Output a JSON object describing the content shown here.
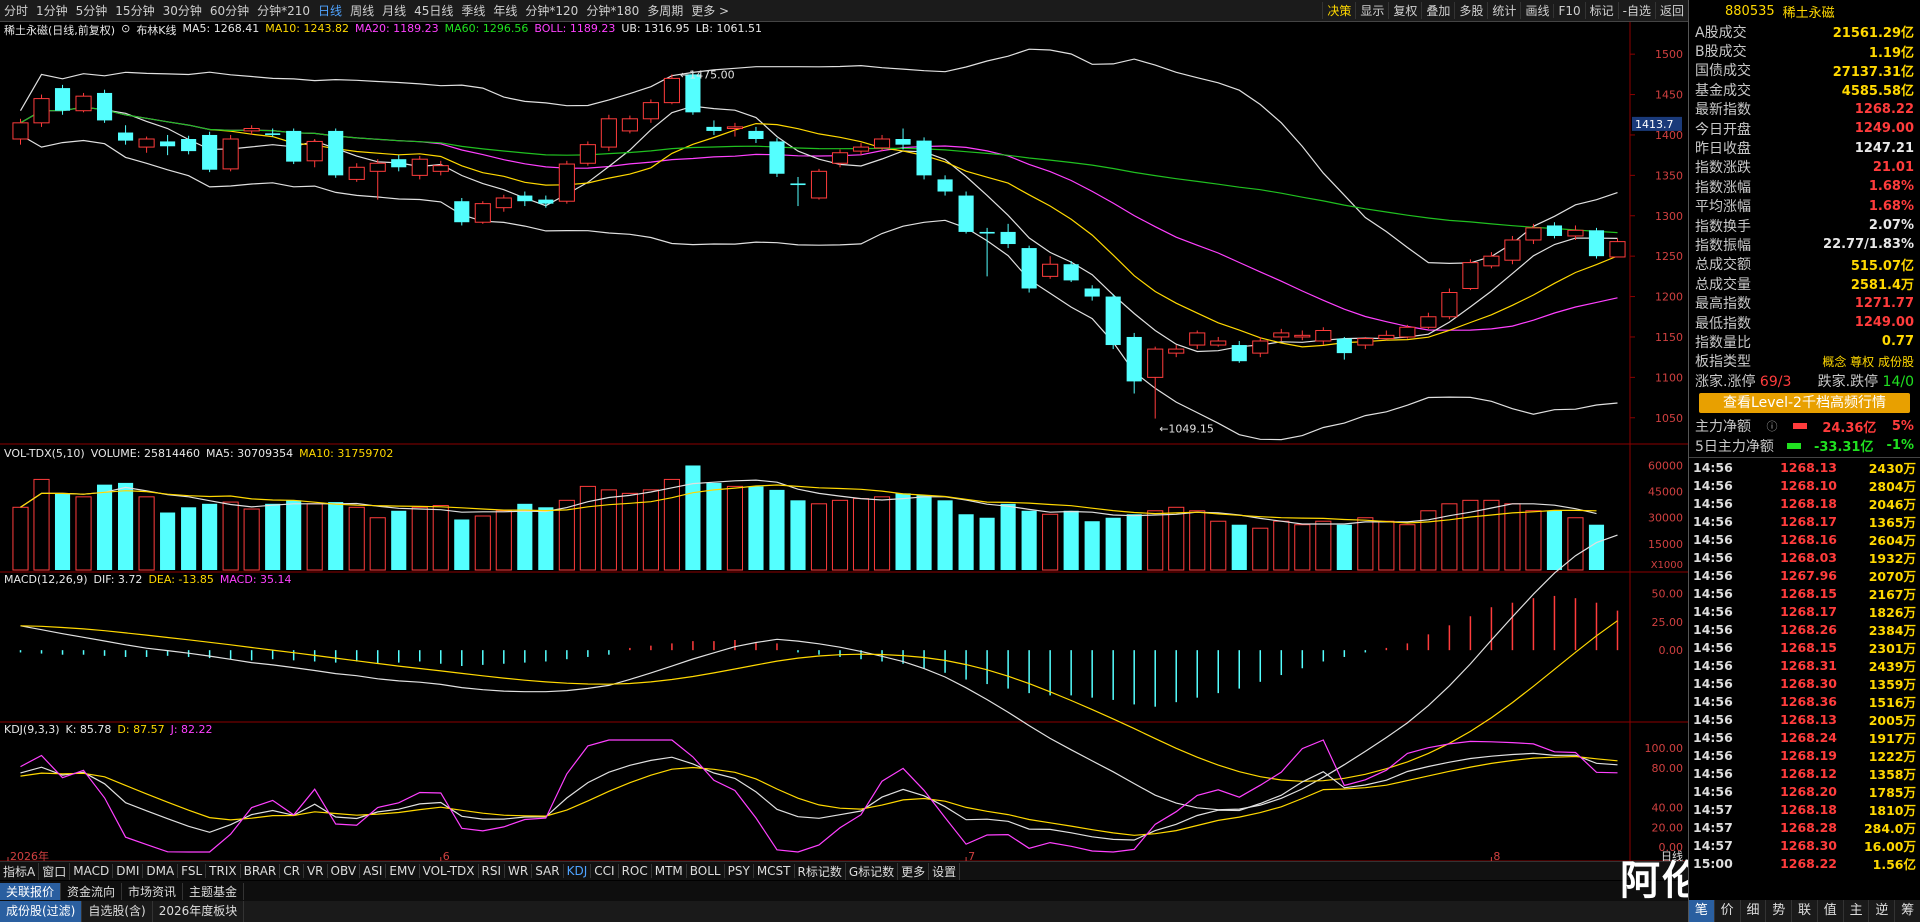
{
  "top_bar": {
    "periods": [
      "分时",
      "1分钟",
      "5分钟",
      "15分钟",
      "30分钟",
      "60分钟",
      "分钟*210",
      "日线",
      "周线",
      "月线",
      "45日线",
      "季线",
      "年线",
      "分钟*120",
      "分钟*180",
      "多周期",
      "更多 >"
    ],
    "active_period": "日线",
    "right_tools": [
      "决策",
      "显示",
      "复权",
      "叠加",
      "多股",
      "统计",
      "画线",
      "F10",
      "标记",
      "-自选",
      "返回"
    ]
  },
  "main_chart": {
    "title": "稀土永磁(日线,前复权)",
    "indicator_name": "布林K线",
    "ma5": "MA5: 1268.41",
    "ma10": "MA10: 1243.82",
    "ma20": "MA20: 1189.23",
    "ma60": "MA60: 1296.56",
    "boll": "BOLL: 1189.23",
    "ub": "UB: 1316.95",
    "lb": "LB: 1061.51",
    "high_label": "1475.00",
    "low_label": "1049.15",
    "current_price_tag": "1413.7",
    "y_ticks": [
      "1500",
      "1450",
      "1400",
      "1350",
      "1300",
      "1250",
      "1200",
      "1150",
      "1100",
      "1050"
    ]
  },
  "volume_chart": {
    "legend": "VOL-TDX(5,10)",
    "volume": "VOLUME: 25814460",
    "ma5": "MA5: 30709354",
    "ma10": "MA10: 31759702",
    "y_ticks": [
      "60000",
      "45000",
      "30000",
      "15000"
    ],
    "unit": "X1000"
  },
  "macd_chart": {
    "legend": "MACD(12,26,9)",
    "dif": "DIF: 3.72",
    "dea": "DEA: -13.85",
    "macd": "MACD: 35.14",
    "y_ticks": [
      "50.00",
      "25.00",
      "0.00"
    ]
  },
  "kdj_chart": {
    "legend": "KDJ(9,3,3)",
    "k": "K: 85.78",
    "d": "D: 87.57",
    "j": "J: 82.22",
    "y_ticks": [
      "100.00",
      "80.00",
      "40.00",
      "20.00",
      "0.00"
    ]
  },
  "x_axis": {
    "labels": [
      "2026年",
      "6",
      "7",
      "8"
    ],
    "period_label": "日线"
  },
  "indicator_tabs": [
    "指标A",
    "窗口",
    "MACD",
    "DMI",
    "DMA",
    "FSL",
    "TRIX",
    "BRAR",
    "CR",
    "VR",
    "OBV",
    "ASI",
    "EMV",
    "VOL-TDX",
    "RSI",
    "WR",
    "SAR",
    "KDJ",
    "CCI",
    "ROC",
    "MTM",
    "BOLL",
    "PSY",
    "MCST",
    "R标记数",
    "G标记数",
    "更多",
    "设置"
  ],
  "active_indicator": "KDJ",
  "info_tabs": [
    "关联报价",
    "资金流向",
    "市场资讯",
    "主题基金"
  ],
  "active_info_tab": "关联报价",
  "bottom_bar": [
    "成份股(过滤)",
    "自选股(含)",
    "2026年度板块"
  ],
  "active_bottom": "成份股(过滤)",
  "watermark": "阿伦股市",
  "right_panel": {
    "code": "880535",
    "name": "稀土永磁",
    "rows": [
      {
        "label": "A股成交",
        "value": "21561.29亿",
        "color": "yel"
      },
      {
        "label": "B股成交",
        "value": "1.19亿",
        "color": "yel"
      },
      {
        "label": "国债成交",
        "value": "27137.31亿",
        "color": "yel"
      },
      {
        "label": "基金成交",
        "value": "4585.58亿",
        "color": "yel"
      },
      {
        "label": "最新指数",
        "value": "1268.22",
        "color": "red"
      },
      {
        "label": "今日开盘",
        "value": "1249.00",
        "color": "red"
      },
      {
        "label": "昨日收盘",
        "value": "1247.21",
        "color": "wht"
      },
      {
        "label": "指数涨跌",
        "value": "21.01",
        "color": "red"
      },
      {
        "label": "指数涨幅",
        "value": "1.68%",
        "color": "red"
      },
      {
        "label": "平均涨幅",
        "value": "1.68%",
        "color": "red"
      },
      {
        "label": "指数换手",
        "value": "2.07%",
        "color": "wht"
      },
      {
        "label": "指数振幅",
        "value": "22.77/1.83%",
        "color": "wht"
      },
      {
        "label": "总成交额",
        "value": "515.07亿",
        "color": "yel"
      },
      {
        "label": "总成交量",
        "value": "2581.4万",
        "color": "yel"
      },
      {
        "label": "最高指数",
        "value": "1271.77",
        "color": "red"
      },
      {
        "label": "最低指数",
        "value": "1249.00",
        "color": "red"
      },
      {
        "label": "指数量比",
        "value": "0.77",
        "color": "yel"
      }
    ],
    "board_type_label": "板指类型",
    "board_type_value": "概念 尊权 成份股",
    "up_down_label": "涨家.涨停",
    "up_down_value": "69/3",
    "fall_label": "跌家.跌停",
    "fall_value": "14/0",
    "level2_button": "查看Level-2千档高频行情",
    "main_flow_label": "主力净额",
    "main_flow_value": "24.36亿",
    "main_flow_pct": "5%",
    "flow5_label": "5日主力净额",
    "flow5_value": "-33.31亿",
    "flow5_pct": "-1%",
    "ticks": [
      {
        "t": "14:56",
        "p": "1268.13",
        "v": "2430万"
      },
      {
        "t": "14:56",
        "p": "1268.10",
        "v": "2804万"
      },
      {
        "t": "14:56",
        "p": "1268.18",
        "v": "2046万"
      },
      {
        "t": "14:56",
        "p": "1268.17",
        "v": "1365万"
      },
      {
        "t": "14:56",
        "p": "1268.16",
        "v": "2604万"
      },
      {
        "t": "14:56",
        "p": "1268.03",
        "v": "1932万"
      },
      {
        "t": "14:56",
        "p": "1267.96",
        "v": "2070万"
      },
      {
        "t": "14:56",
        "p": "1268.15",
        "v": "2167万"
      },
      {
        "t": "14:56",
        "p": "1268.17",
        "v": "1826万"
      },
      {
        "t": "14:56",
        "p": "1268.26",
        "v": "2384万"
      },
      {
        "t": "14:56",
        "p": "1268.15",
        "v": "2301万"
      },
      {
        "t": "14:56",
        "p": "1268.31",
        "v": "2439万"
      },
      {
        "t": "14:56",
        "p": "1268.30",
        "v": "1359万"
      },
      {
        "t": "14:56",
        "p": "1268.36",
        "v": "1516万"
      },
      {
        "t": "14:56",
        "p": "1268.13",
        "v": "2005万"
      },
      {
        "t": "14:56",
        "p": "1268.24",
        "v": "1917万"
      },
      {
        "t": "14:56",
        "p": "1268.19",
        "v": "1222万"
      },
      {
        "t": "14:56",
        "p": "1268.12",
        "v": "1358万"
      },
      {
        "t": "14:56",
        "p": "1268.20",
        "v": "1785万"
      },
      {
        "t": "14:57",
        "p": "1268.18",
        "v": "1810万"
      },
      {
        "t": "14:57",
        "p": "1268.28",
        "v": "284.0万"
      },
      {
        "t": "14:57",
        "p": "1268.30",
        "v": "16.00万"
      },
      {
        "t": "15:00",
        "p": "1268.22",
        "v": "1.56亿"
      }
    ],
    "bottom_tabs": [
      "笔",
      "价",
      "细",
      "势",
      "联",
      "值",
      "主",
      "逆",
      "筹"
    ],
    "active_bottom_tab": "笔"
  },
  "candles": [
    {
      "o": 1395,
      "c": 1415,
      "h": 1420,
      "l": 1388
    },
    {
      "o": 1415,
      "c": 1445,
      "h": 1450,
      "l": 1410
    },
    {
      "o": 1458,
      "c": 1430,
      "h": 1462,
      "l": 1425
    },
    {
      "o": 1430,
      "c": 1448,
      "h": 1452,
      "l": 1428
    },
    {
      "o": 1452,
      "c": 1418,
      "h": 1456,
      "l": 1415
    },
    {
      "o": 1403,
      "c": 1393,
      "h": 1412,
      "l": 1388
    },
    {
      "o": 1385,
      "c": 1395,
      "h": 1398,
      "l": 1378
    },
    {
      "o": 1392,
      "c": 1386,
      "h": 1400,
      "l": 1375
    },
    {
      "o": 1395,
      "c": 1380,
      "h": 1399,
      "l": 1376
    },
    {
      "o": 1400,
      "c": 1357,
      "h": 1404,
      "l": 1354
    },
    {
      "o": 1358,
      "c": 1395,
      "h": 1400,
      "l": 1355
    },
    {
      "o": 1405,
      "c": 1408,
      "h": 1412,
      "l": 1400
    },
    {
      "o": 1402,
      "c": 1400,
      "h": 1408,
      "l": 1398
    },
    {
      "o": 1405,
      "c": 1367,
      "h": 1408,
      "l": 1364
    },
    {
      "o": 1368,
      "c": 1392,
      "h": 1395,
      "l": 1360
    },
    {
      "o": 1405,
      "c": 1350,
      "h": 1408,
      "l": 1347
    },
    {
      "o": 1345,
      "c": 1360,
      "h": 1365,
      "l": 1342
    },
    {
      "o": 1355,
      "c": 1365,
      "h": 1370,
      "l": 1320
    },
    {
      "o": 1370,
      "c": 1360,
      "h": 1375,
      "l": 1355
    },
    {
      "o": 1350,
      "c": 1370,
      "h": 1374,
      "l": 1345
    },
    {
      "o": 1355,
      "c": 1362,
      "h": 1368,
      "l": 1350
    },
    {
      "o": 1318,
      "c": 1292,
      "h": 1322,
      "l": 1288
    },
    {
      "o": 1292,
      "c": 1315,
      "h": 1318,
      "l": 1290
    },
    {
      "o": 1310,
      "c": 1322,
      "h": 1326,
      "l": 1305
    },
    {
      "o": 1325,
      "c": 1318,
      "h": 1330,
      "l": 1312
    },
    {
      "o": 1320,
      "c": 1315,
      "h": 1325,
      "l": 1310
    },
    {
      "o": 1318,
      "c": 1364,
      "h": 1368,
      "l": 1315
    },
    {
      "o": 1365,
      "c": 1388,
      "h": 1392,
      "l": 1362
    },
    {
      "o": 1385,
      "c": 1420,
      "h": 1425,
      "l": 1380
    },
    {
      "o": 1405,
      "c": 1420,
      "h": 1424,
      "l": 1402
    },
    {
      "o": 1420,
      "c": 1440,
      "h": 1444,
      "l": 1415
    },
    {
      "o": 1440,
      "c": 1470,
      "h": 1475,
      "l": 1438
    },
    {
      "o": 1475,
      "c": 1428,
      "h": 1478,
      "l": 1425
    },
    {
      "o": 1410,
      "c": 1405,
      "h": 1418,
      "l": 1400
    },
    {
      "o": 1408,
      "c": 1410,
      "h": 1415,
      "l": 1398
    },
    {
      "o": 1405,
      "c": 1395,
      "h": 1410,
      "l": 1390
    },
    {
      "o": 1392,
      "c": 1352,
      "h": 1396,
      "l": 1348
    },
    {
      "o": 1340,
      "c": 1338,
      "h": 1348,
      "l": 1312
    },
    {
      "o": 1322,
      "c": 1355,
      "h": 1358,
      "l": 1320
    },
    {
      "o": 1365,
      "c": 1378,
      "h": 1382,
      "l": 1360
    },
    {
      "o": 1380,
      "c": 1385,
      "h": 1390,
      "l": 1375
    },
    {
      "o": 1384,
      "c": 1395,
      "h": 1400,
      "l": 1380
    },
    {
      "o": 1395,
      "c": 1388,
      "h": 1408,
      "l": 1382
    },
    {
      "o": 1393,
      "c": 1350,
      "h": 1397,
      "l": 1345
    },
    {
      "o": 1345,
      "c": 1330,
      "h": 1350,
      "l": 1325
    },
    {
      "o": 1325,
      "c": 1280,
      "h": 1330,
      "l": 1278
    },
    {
      "o": 1280,
      "c": 1278,
      "h": 1285,
      "l": 1225
    },
    {
      "o": 1280,
      "c": 1265,
      "h": 1290,
      "l": 1260
    },
    {
      "o": 1260,
      "c": 1210,
      "h": 1263,
      "l": 1205
    },
    {
      "o": 1225,
      "c": 1240,
      "h": 1250,
      "l": 1222
    },
    {
      "o": 1240,
      "c": 1220,
      "h": 1244,
      "l": 1218
    },
    {
      "o": 1210,
      "c": 1200,
      "h": 1214,
      "l": 1195
    },
    {
      "o": 1200,
      "c": 1140,
      "h": 1203,
      "l": 1135
    },
    {
      "o": 1150,
      "c": 1095,
      "h": 1155,
      "l": 1080
    },
    {
      "o": 1100,
      "c": 1135,
      "h": 1138,
      "l": 1049
    },
    {
      "o": 1130,
      "c": 1135,
      "h": 1140,
      "l": 1125
    },
    {
      "o": 1140,
      "c": 1155,
      "h": 1158,
      "l": 1135
    },
    {
      "o": 1140,
      "c": 1145,
      "h": 1150,
      "l": 1138
    },
    {
      "o": 1140,
      "c": 1120,
      "h": 1145,
      "l": 1118
    },
    {
      "o": 1130,
      "c": 1145,
      "h": 1150,
      "l": 1125
    },
    {
      "o": 1150,
      "c": 1155,
      "h": 1160,
      "l": 1145
    },
    {
      "o": 1150,
      "c": 1152,
      "h": 1158,
      "l": 1146
    },
    {
      "o": 1145,
      "c": 1158,
      "h": 1162,
      "l": 1140
    },
    {
      "o": 1148,
      "c": 1130,
      "h": 1150,
      "l": 1122
    },
    {
      "o": 1140,
      "c": 1148,
      "h": 1150,
      "l": 1135
    },
    {
      "o": 1148,
      "c": 1152,
      "h": 1158,
      "l": 1146
    },
    {
      "o": 1150,
      "c": 1162,
      "h": 1165,
      "l": 1148
    },
    {
      "o": 1162,
      "c": 1175,
      "h": 1180,
      "l": 1160
    },
    {
      "o": 1175,
      "c": 1205,
      "h": 1210,
      "l": 1172
    },
    {
      "o": 1210,
      "c": 1242,
      "h": 1246,
      "l": 1208
    },
    {
      "o": 1238,
      "c": 1250,
      "h": 1255,
      "l": 1235
    },
    {
      "o": 1245,
      "c": 1270,
      "h": 1275,
      "l": 1240
    },
    {
      "o": 1270,
      "c": 1285,
      "h": 1290,
      "l": 1265
    },
    {
      "o": 1288,
      "c": 1275,
      "h": 1292,
      "l": 1272
    },
    {
      "o": 1275,
      "c": 1282,
      "h": 1288,
      "l": 1270
    },
    {
      "o": 1282,
      "c": 1250,
      "h": 1285,
      "l": 1247
    },
    {
      "o": 1249,
      "c": 1268,
      "h": 1272,
      "l": 1249
    }
  ],
  "volumes": [
    36000,
    52000,
    44000,
    42000,
    49000,
    50000,
    42000,
    33000,
    36000,
    38000,
    39000,
    35000,
    38000,
    40000,
    38000,
    39000,
    36000,
    30000,
    34000,
    36000,
    37000,
    29000,
    31000,
    34000,
    38000,
    36000,
    40000,
    48000,
    46000,
    44000,
    46000,
    52000,
    60000,
    50000,
    48000,
    48000,
    46000,
    40000,
    38000,
    40000,
    41000,
    42000,
    44000,
    43000,
    40000,
    32000,
    30000,
    38000,
    34000,
    32000,
    34000,
    28000,
    30000,
    32000,
    34000,
    36000,
    34000,
    28000,
    26000,
    24000,
    28000,
    26000,
    28000,
    26000,
    30000,
    28000,
    26000,
    34000,
    38000,
    40000,
    40000,
    38000,
    34000,
    34000,
    30000,
    26000
  ],
  "macd_values": [
    -2,
    -3,
    -4,
    -4,
    -5,
    -6,
    -6,
    -5,
    -6,
    -7,
    -8,
    -9,
    -8,
    -9,
    -10,
    -11,
    -10,
    -12,
    -11,
    -10,
    -12,
    -14,
    -13,
    -12,
    -11,
    -10,
    -8,
    -6,
    -4,
    2,
    4,
    6,
    8,
    8,
    9,
    7,
    6,
    -2,
    -4,
    -6,
    -8,
    -10,
    -12,
    -16,
    -20,
    -26,
    -30,
    -34,
    -38,
    -40,
    -40,
    -42,
    -44,
    -48,
    -50,
    -46,
    -42,
    -38,
    -34,
    -28,
    -22,
    -16,
    -10,
    -6,
    -2,
    2,
    6,
    14,
    22,
    30,
    38,
    42,
    46,
    48,
    46,
    42,
    35
  ]
}
